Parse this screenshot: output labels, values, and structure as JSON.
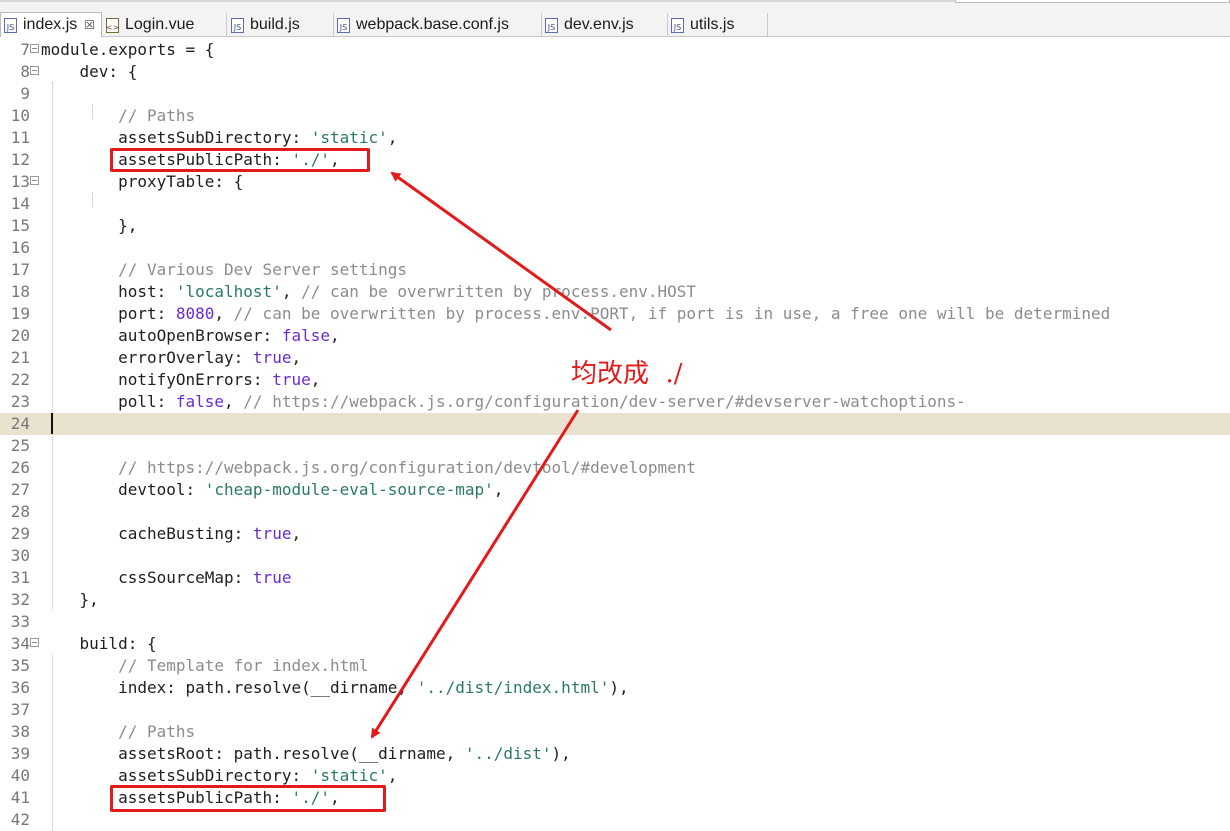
{
  "tabs": [
    {
      "name": "index.js",
      "icon": "js-file-icon",
      "active": true,
      "closable": true
    },
    {
      "name": "Login.vue",
      "icon": "vue-file-icon",
      "active": false,
      "closable": false
    },
    {
      "name": "build.js",
      "icon": "js-file-icon",
      "active": false,
      "closable": false
    },
    {
      "name": "webpack.base.conf.js",
      "icon": "js-file-icon",
      "active": false,
      "closable": false
    },
    {
      "name": "dev.env.js",
      "icon": "js-file-icon",
      "active": false,
      "closable": false
    },
    {
      "name": "utils.js",
      "icon": "js-file-icon",
      "active": false,
      "closable": false
    }
  ],
  "editor": {
    "current_line": 24,
    "lines": [
      {
        "n": 7,
        "fold": true,
        "tokens": [
          [
            "p",
            "module.exports = {"
          ]
        ]
      },
      {
        "n": 8,
        "fold": true,
        "tokens": [
          [
            "p",
            "    dev: {"
          ]
        ]
      },
      {
        "n": 9,
        "fold": false,
        "tokens": []
      },
      {
        "n": 10,
        "fold": false,
        "tokens": [
          [
            "p",
            "        "
          ],
          [
            "c",
            "// Paths"
          ]
        ]
      },
      {
        "n": 11,
        "fold": false,
        "tokens": [
          [
            "p",
            "        assetsSubDirectory: "
          ],
          [
            "s",
            "'static'"
          ],
          [
            "p",
            ","
          ]
        ]
      },
      {
        "n": 12,
        "fold": false,
        "tokens": [
          [
            "p",
            "        assetsPublicPath: "
          ],
          [
            "s",
            "'./'"
          ],
          [
            "p",
            ","
          ]
        ]
      },
      {
        "n": 13,
        "fold": true,
        "tokens": [
          [
            "p",
            "        proxyTable: {"
          ]
        ]
      },
      {
        "n": 14,
        "fold": false,
        "tokens": []
      },
      {
        "n": 15,
        "fold": false,
        "tokens": [
          [
            "p",
            "        },"
          ]
        ]
      },
      {
        "n": 16,
        "fold": false,
        "tokens": []
      },
      {
        "n": 17,
        "fold": false,
        "tokens": [
          [
            "p",
            "        "
          ],
          [
            "c",
            "// Various Dev Server settings"
          ]
        ]
      },
      {
        "n": 18,
        "fold": false,
        "tokens": [
          [
            "p",
            "        host: "
          ],
          [
            "s",
            "'localhost'"
          ],
          [
            "p",
            ", "
          ],
          [
            "c",
            "// can be overwritten by process.env.HOST"
          ]
        ]
      },
      {
        "n": 19,
        "fold": false,
        "tokens": [
          [
            "p",
            "        port: "
          ],
          [
            "n",
            "8080"
          ],
          [
            "p",
            ", "
          ],
          [
            "c",
            "// can be overwritten by process.env.PORT, if port is in use, a free one will be determined"
          ]
        ]
      },
      {
        "n": 20,
        "fold": false,
        "tokens": [
          [
            "p",
            "        autoOpenBrowser: "
          ],
          [
            "k",
            "false"
          ],
          [
            "p",
            ","
          ]
        ]
      },
      {
        "n": 21,
        "fold": false,
        "tokens": [
          [
            "p",
            "        errorOverlay: "
          ],
          [
            "k",
            "true"
          ],
          [
            "p",
            ","
          ]
        ]
      },
      {
        "n": 22,
        "fold": false,
        "tokens": [
          [
            "p",
            "        notifyOnErrors: "
          ],
          [
            "k",
            "true"
          ],
          [
            "p",
            ","
          ]
        ]
      },
      {
        "n": 23,
        "fold": false,
        "tokens": [
          [
            "p",
            "        poll: "
          ],
          [
            "k",
            "false"
          ],
          [
            "p",
            ", "
          ],
          [
            "c",
            "// https://webpack.js.org/configuration/dev-server/#devserver-watchoptions-"
          ]
        ]
      },
      {
        "n": 24,
        "fold": false,
        "tokens": []
      },
      {
        "n": 25,
        "fold": false,
        "tokens": []
      },
      {
        "n": 26,
        "fold": false,
        "tokens": [
          [
            "p",
            "        "
          ],
          [
            "c",
            "// https://webpack.js.org/configuration/devtool/#development"
          ]
        ]
      },
      {
        "n": 27,
        "fold": false,
        "tokens": [
          [
            "p",
            "        devtool: "
          ],
          [
            "s",
            "'cheap-module-eval-source-map'"
          ],
          [
            "p",
            ","
          ]
        ]
      },
      {
        "n": 28,
        "fold": false,
        "tokens": []
      },
      {
        "n": 29,
        "fold": false,
        "tokens": [
          [
            "p",
            "        cacheBusting: "
          ],
          [
            "k",
            "true"
          ],
          [
            "p",
            ","
          ]
        ]
      },
      {
        "n": 30,
        "fold": false,
        "tokens": []
      },
      {
        "n": 31,
        "fold": false,
        "tokens": [
          [
            "p",
            "        cssSourceMap: "
          ],
          [
            "k",
            "true"
          ]
        ]
      },
      {
        "n": 32,
        "fold": false,
        "tokens": [
          [
            "p",
            "    },"
          ]
        ]
      },
      {
        "n": 33,
        "fold": false,
        "tokens": []
      },
      {
        "n": 34,
        "fold": true,
        "tokens": [
          [
            "p",
            "    build: {"
          ]
        ]
      },
      {
        "n": 35,
        "fold": false,
        "tokens": [
          [
            "p",
            "        "
          ],
          [
            "c",
            "// Template for index.html"
          ]
        ]
      },
      {
        "n": 36,
        "fold": false,
        "tokens": [
          [
            "p",
            "        index: path.resolve(__dirname, "
          ],
          [
            "s",
            "'../dist/index.html'"
          ],
          [
            "p",
            "),"
          ]
        ]
      },
      {
        "n": 37,
        "fold": false,
        "tokens": []
      },
      {
        "n": 38,
        "fold": false,
        "tokens": [
          [
            "p",
            "        "
          ],
          [
            "c",
            "// Paths"
          ]
        ]
      },
      {
        "n": 39,
        "fold": false,
        "tokens": [
          [
            "p",
            "        assetsRoot: path.resolve(__dirname, "
          ],
          [
            "s",
            "'../dist'"
          ],
          [
            "p",
            "),"
          ]
        ]
      },
      {
        "n": 40,
        "fold": false,
        "tokens": [
          [
            "p",
            "        assetsSubDirectory: "
          ],
          [
            "s",
            "'static'"
          ],
          [
            "p",
            ","
          ]
        ]
      },
      {
        "n": 41,
        "fold": false,
        "tokens": [
          [
            "p",
            "        assetsPublicPath: "
          ],
          [
            "s",
            "'./'"
          ],
          [
            "p",
            ","
          ]
        ]
      },
      {
        "n": 42,
        "fold": false,
        "tokens": []
      }
    ]
  },
  "annotation": {
    "text": "均改成  ./",
    "color": "#e31a1a",
    "highlighted_lines": [
      12,
      41
    ]
  }
}
